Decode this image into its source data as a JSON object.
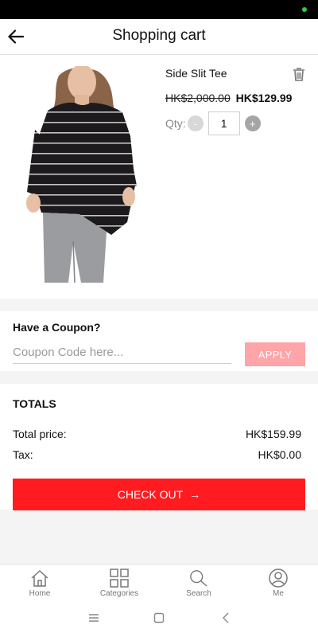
{
  "header": {
    "title": "Shopping cart",
    "back_icon": "arrow-left-icon"
  },
  "product": {
    "name": "Side Slit Tee",
    "original_price": "HK$2,000.00",
    "sale_price": "HK$129.99",
    "qty_label": "Qty:",
    "qty_value": "1",
    "minus_label": "-",
    "plus_label": "+",
    "delete_icon": "trash-icon",
    "image_alt": "striped long-sleeve tee"
  },
  "coupon": {
    "title": "Have a Coupon?",
    "placeholder": "Coupon Code here...",
    "value": "",
    "apply_label": "APPLY"
  },
  "totals": {
    "title": "TOTALS",
    "total_label": "Total price:",
    "total_value": "HK$159.99",
    "tax_label": "Tax:",
    "tax_value": "HK$0.00",
    "checkout_label": "CHECK OUT",
    "checkout_arrow": "→"
  },
  "nav": {
    "items": [
      {
        "label": "Home",
        "icon": "home-icon"
      },
      {
        "label": "Categories",
        "icon": "grid-icon"
      },
      {
        "label": "Search",
        "icon": "search-icon"
      },
      {
        "label": "Me",
        "icon": "user-icon"
      }
    ]
  },
  "colors": {
    "accent": "#ff1b1f",
    "apply_bg": "#ffa4a8",
    "page_bg": "#f4f4f5"
  }
}
